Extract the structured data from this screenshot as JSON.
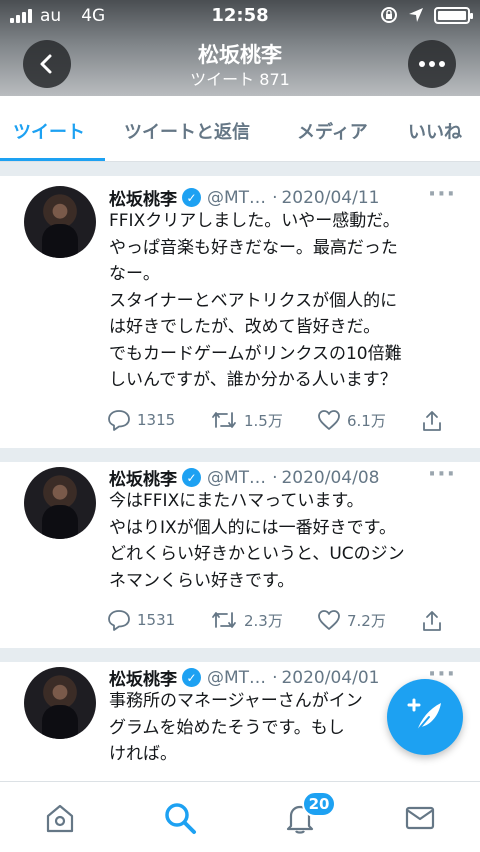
{
  "status_bar": {
    "carrier": "au",
    "network": "4G",
    "time": "12:58"
  },
  "header": {
    "title": "松坂桃李",
    "subtitle": "ツイート 871"
  },
  "tabs": [
    {
      "label": "ツイート",
      "active": true
    },
    {
      "label": "ツイートと返信",
      "active": false
    },
    {
      "label": "メディア",
      "active": false
    },
    {
      "label": "いいね",
      "active": false
    }
  ],
  "tweets": [
    {
      "name": "松坂桃李",
      "handle": "@MT…",
      "separator": "·",
      "date": "2020/04/11",
      "lines": [
        "FFIXクリアしました。いやー感動だ。",
        "やっぱ音楽も好きだなー。最高だった",
        "なー。",
        "スタイナーとベアトリクスが個人的に",
        "は好きでしたが、改めて皆好きだ。",
        "でもカードゲームがリンクスの10倍難",
        "しいんですが、誰か分かる人います？"
      ],
      "replies": "1315",
      "retweets": "1.5万",
      "likes": "6.1万"
    },
    {
      "name": "松坂桃李",
      "handle": "@MT…",
      "separator": "·",
      "date": "2020/04/08",
      "lines": [
        "今はFFIXにまたハマっています。",
        "やはりIXが個人的には一番好きです。",
        "どれくらい好きかというと、UCのジン",
        "ネマンくらい好きです。"
      ],
      "replies": "1531",
      "retweets": "2.3万",
      "likes": "7.2万"
    },
    {
      "name": "松坂桃李",
      "handle": "@MT…",
      "separator": "·",
      "date": "2020/04/01",
      "lines": [
        "事務所のマネージャーさんがイン",
        "グラムを始めたそうです。もし",
        "ければ。"
      ]
    }
  ],
  "notifications_badge": "20",
  "colors": {
    "accent": "#1da1f2",
    "text_secondary": "#657786"
  }
}
